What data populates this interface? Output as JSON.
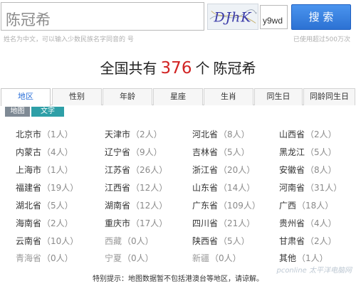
{
  "search": {
    "query_value": "陈冠希",
    "captcha_text": "DJhK",
    "captcha_value": "y9wd",
    "button_label": "搜 索",
    "hint_left": "姓名为中文，可以输入少数民族名字同音的 号",
    "hint_right": "已使用超过500万次"
  },
  "headline": {
    "prefix": "全国共有",
    "count": "376",
    "unit": "个",
    "name": "陈冠希"
  },
  "tabs": [
    "地区",
    "性别",
    "年龄",
    "星座",
    "生肖",
    "同生日",
    "同龄同生日"
  ],
  "subtabs": {
    "map": "地图",
    "text": "文字"
  },
  "regions": [
    {
      "name": "北京市",
      "count": "（1人）"
    },
    {
      "name": "天津市",
      "count": "（2人）"
    },
    {
      "name": "河北省",
      "count": "（8人）"
    },
    {
      "name": "山西省",
      "count": "（2人）"
    },
    {
      "name": "内蒙古",
      "count": "（4人）"
    },
    {
      "name": "辽宁省",
      "count": "（9人）"
    },
    {
      "name": "吉林省",
      "count": "（5人）"
    },
    {
      "name": "黑龙江",
      "count": "（5人）"
    },
    {
      "name": "上海市",
      "count": "（1人）"
    },
    {
      "name": "江苏省",
      "count": "（26人）"
    },
    {
      "name": "浙江省",
      "count": "（20人）"
    },
    {
      "name": "安徽省",
      "count": "（8人）"
    },
    {
      "name": "福建省",
      "count": "（19人）"
    },
    {
      "name": "江西省",
      "count": "（12人）"
    },
    {
      "name": "山东省",
      "count": "（14人）"
    },
    {
      "name": "河南省",
      "count": "（31人）"
    },
    {
      "name": "湖北省",
      "count": "（5人）"
    },
    {
      "name": "湖南省",
      "count": "（12人）"
    },
    {
      "name": "广东省",
      "count": "（109人）"
    },
    {
      "name": "广西",
      "count": "（18人）"
    },
    {
      "name": "海南省",
      "count": "（2人）"
    },
    {
      "name": "重庆市",
      "count": "（17人）"
    },
    {
      "name": "四川省",
      "count": "（21人）"
    },
    {
      "name": "贵州省",
      "count": "（4人）"
    },
    {
      "name": "云南省",
      "count": "（10人）"
    },
    {
      "name": "西藏",
      "count": "（0人）"
    },
    {
      "name": "陕西省",
      "count": "（5人）"
    },
    {
      "name": "甘肃省",
      "count": "（2人）"
    },
    {
      "name": "青海省",
      "count": "（0人）"
    },
    {
      "name": "宁夏",
      "count": "（0人）"
    },
    {
      "name": "新疆",
      "count": "（0人）"
    },
    {
      "name": "其他",
      "count": "（1人）"
    }
  ],
  "note": "特别提示：地图数据暂不包括港澳台等地区，请谅解。",
  "watermark": "pconline 太平洋电脑网"
}
